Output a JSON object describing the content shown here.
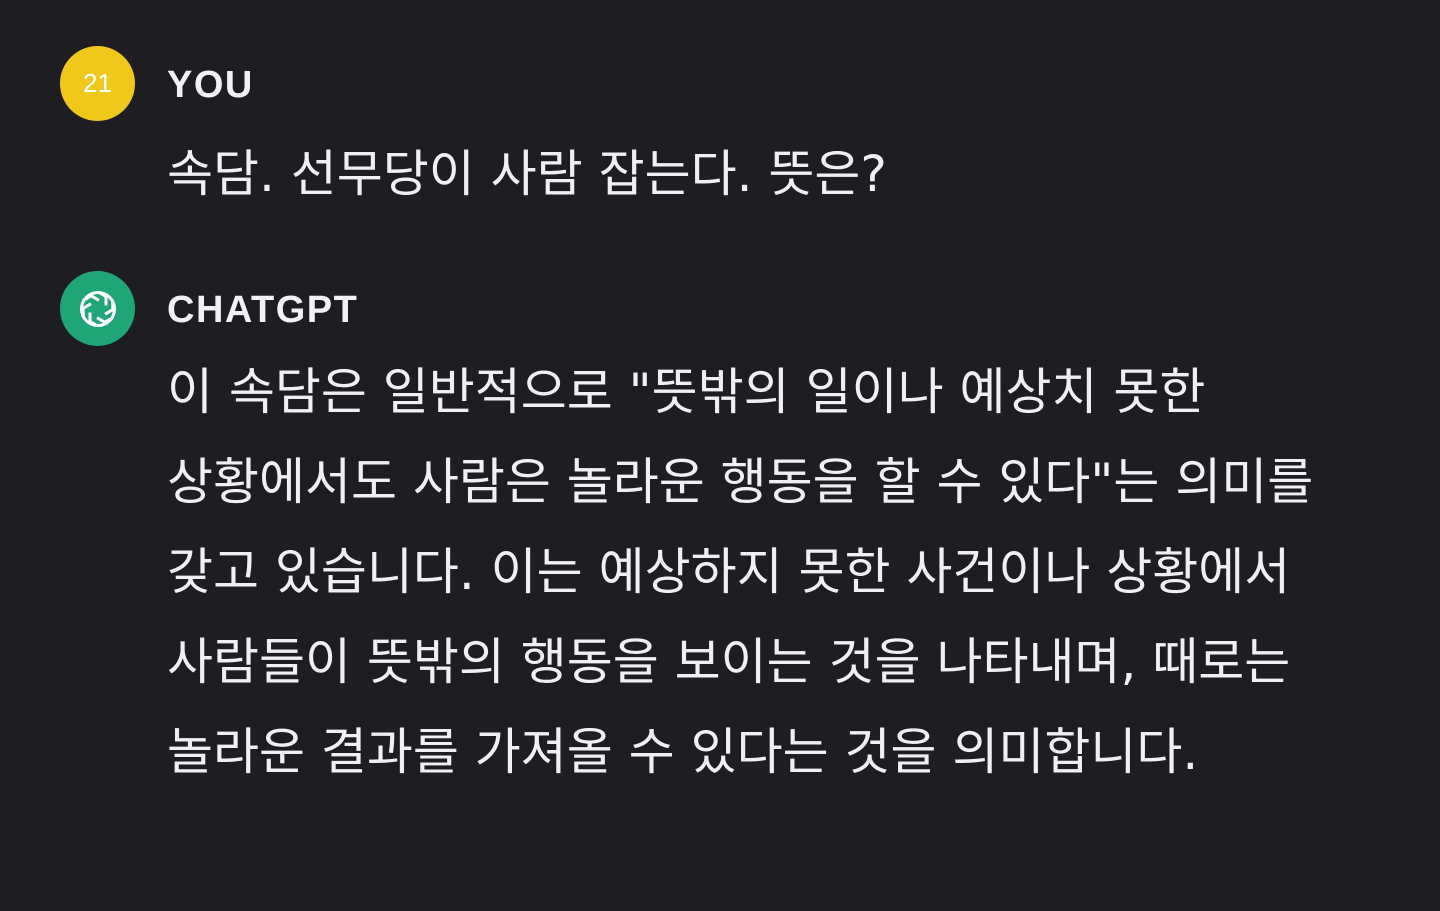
{
  "conversation": {
    "messages": [
      {
        "role": "user",
        "avatar_text": "21",
        "avatar_color": "#f0c81c",
        "author": "YOU",
        "text": "속담. 선무당이 사람 잡는다. 뜻은?"
      },
      {
        "role": "assistant",
        "avatar_icon": "openai-logo-icon",
        "avatar_color": "#1fa576",
        "author": "CHATGPT",
        "text": "이 속담은 일반적으로 \"뜻밖의 일이나 예상치 못한 상황에서도 사람은 놀라운 행동을 할 수 있다\"는 의미를 갖고 있습니다. 이는 예상하지 못한 사건이나 상황에서 사람들이 뜻밖의 행동을 보이는 것을 나타내며, 때로는 놀라운 결과를 가져올 수 있다는 것을 의미합니다."
      }
    ]
  },
  "theme": {
    "background": "#1e1d21",
    "text": "#f0f0f3"
  }
}
